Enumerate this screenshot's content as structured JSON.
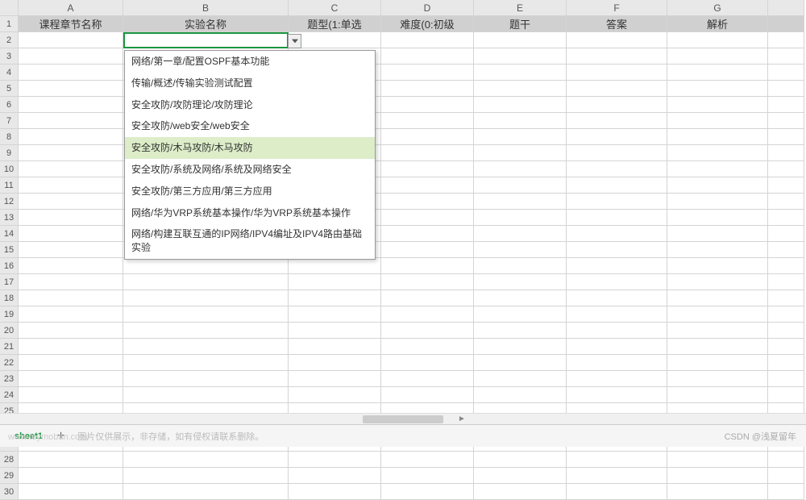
{
  "columns": [
    "A",
    "B",
    "C",
    "D",
    "E",
    "F",
    "G",
    ""
  ],
  "headers": {
    "A": "课程章节名称",
    "B": "实验名称",
    "C": "题型(1:单选",
    "D": "难度(0:初级",
    "E": "题干",
    "F": "答案",
    "G": "解析"
  },
  "row_count": 30,
  "active_cell": "B2",
  "dropdown": {
    "items": [
      "网络/第一章/配置OSPF基本功能",
      "传输/概述/传输实验测试配置",
      "安全攻防/攻防理论/攻防理论",
      "安全攻防/web安全/web安全",
      "安全攻防/木马攻防/木马攻防",
      "安全攻防/系统及网络/系统及网络安全",
      "安全攻防/第三方应用/第三方应用",
      "网络/华为VRP系统基本操作/华为VRP系统基本操作",
      "网络/构建互联互通的IP网络/IPV4编址及IPV4路由基础实验"
    ],
    "highlighted_index": 4
  },
  "footer": {
    "sheet_tab": "sheet1",
    "note": "图片仅供展示，非存储，如有侵权请联系删除。",
    "watermark_left": "www.toymoban.com",
    "watermark_right": "CSDN @浅夏留年"
  }
}
